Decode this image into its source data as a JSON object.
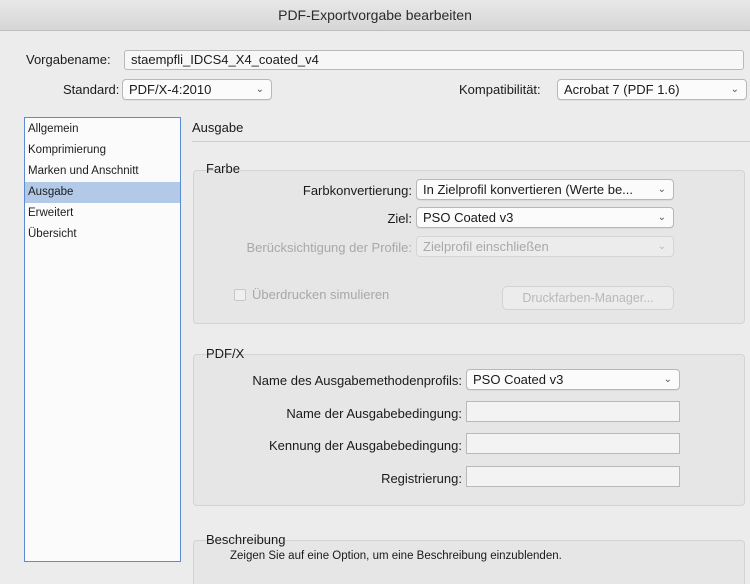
{
  "window": {
    "title": "PDF-Exportvorgabe bearbeiten"
  },
  "top": {
    "preset_name_label": "Vorgabename:",
    "preset_name_value": "staempfli_IDCS4_X4_coated_v4",
    "standard_label": "Standard:",
    "standard_value": "PDF/X-4:2010",
    "compat_label": "Kompatibilität:",
    "compat_value": "Acrobat 7 (PDF 1.6)"
  },
  "sidebar": {
    "items": [
      {
        "label": "Allgemein"
      },
      {
        "label": "Komprimierung"
      },
      {
        "label": "Marken und Anschnitt"
      },
      {
        "label": "Ausgabe"
      },
      {
        "label": "Erweitert"
      },
      {
        "label": "Übersicht"
      }
    ],
    "selected_index": 3
  },
  "main": {
    "section_title": "Ausgabe",
    "farbe": {
      "title": "Farbe",
      "conversion_label": "Farbkonvertierung:",
      "conversion_value": "In Zielprofil konvertieren (Werte be...",
      "target_label": "Ziel:",
      "target_value": "PSO Coated v3",
      "profiles_label": "Berücksichtigung der Profile:",
      "profiles_value": "Zielprofil einschließen",
      "overprint_label": "Überdrucken simulieren",
      "ink_manager_label": "Druckfarben-Manager..."
    },
    "pdfx": {
      "title": "PDF/X",
      "output_profile_label": "Name des Ausgabemethodenprofils:",
      "output_profile_value": "PSO Coated v3",
      "condition_name_label": "Name der Ausgabebedingung:",
      "condition_id_label": "Kennung der Ausgabebedingung:",
      "registry_label": "Registrierung:"
    },
    "description": {
      "title": "Beschreibung",
      "text": "Zeigen Sie auf eine Option, um eine Beschreibung einzublenden."
    }
  }
}
